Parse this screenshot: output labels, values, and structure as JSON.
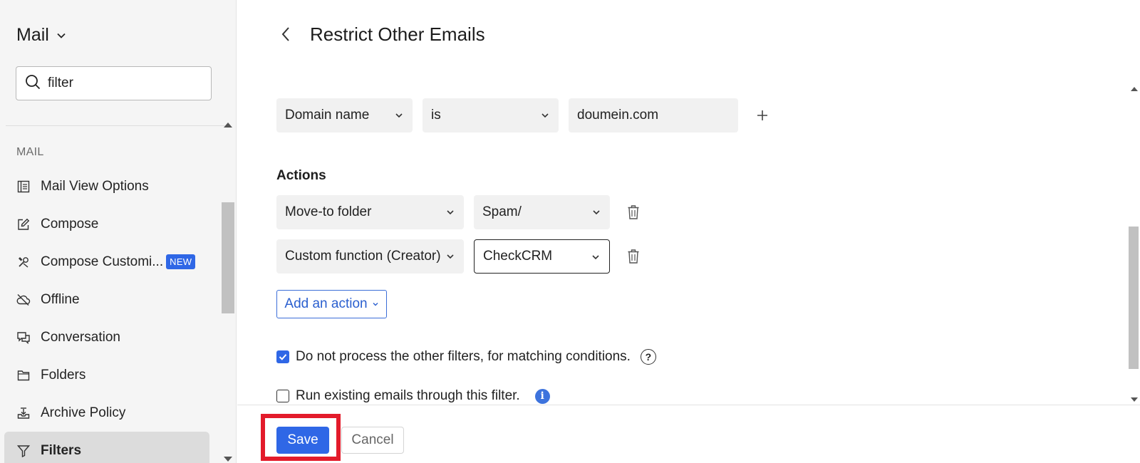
{
  "sidebar": {
    "app_title": "Mail",
    "search": {
      "value": "filter"
    },
    "section_label": "MAIL",
    "items": [
      {
        "label": "Mail View Options",
        "icon": "layout-icon"
      },
      {
        "label": "Compose",
        "icon": "edit-icon"
      },
      {
        "label": "Compose Customi...",
        "icon": "tools-icon",
        "badge": "NEW"
      },
      {
        "label": "Offline",
        "icon": "cloud-off-icon"
      },
      {
        "label": "Conversation",
        "icon": "chat-icon"
      },
      {
        "label": "Folders",
        "icon": "folder-icon"
      },
      {
        "label": "Archive Policy",
        "icon": "archive-icon"
      },
      {
        "label": "Filters",
        "icon": "filter-icon",
        "active": true
      }
    ]
  },
  "main": {
    "title": "Restrict Other Emails",
    "condition": {
      "field": "Domain name",
      "operator": "is",
      "value": "doumein.com"
    },
    "actions_label": "Actions",
    "actions": [
      {
        "type": "Move-to folder",
        "value": "Spam/"
      },
      {
        "type": "Custom function (Creator)",
        "value": "CheckCRM"
      }
    ],
    "add_action_label": "Add an action",
    "options": [
      {
        "label": "Do not process the other filters, for matching conditions.",
        "checked": true
      },
      {
        "label": "Run existing emails through this filter.",
        "checked": false
      }
    ],
    "save_label": "Save",
    "cancel_label": "Cancel"
  },
  "colors": {
    "accent": "#2f67e6",
    "highlight": "#e31b2b"
  }
}
